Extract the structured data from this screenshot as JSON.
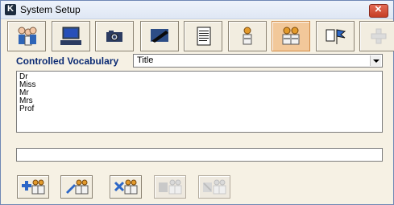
{
  "window": {
    "title": "System Setup",
    "app_icon": "k-app-icon",
    "close_icon": "close-icon"
  },
  "toolbar": {
    "buttons": [
      {
        "icon": "people-icon",
        "active": false
      },
      {
        "icon": "computer-icon",
        "active": false
      },
      {
        "icon": "camera-icon",
        "active": false
      },
      {
        "icon": "pen-icon",
        "active": false
      },
      {
        "icon": "document-icon",
        "active": false
      },
      {
        "icon": "person-icon",
        "active": false
      },
      {
        "icon": "two-people-icon",
        "active": true
      },
      {
        "icon": "flag-icon",
        "active": false
      },
      {
        "icon": "plus-disabled-icon",
        "active": false
      }
    ]
  },
  "controlled_vocabulary": {
    "label": "Controlled Vocabulary",
    "selected": "Title",
    "items": [
      "Dr",
      "Miss",
      "Mr",
      "Mrs",
      "Prof"
    ],
    "entry_value": ""
  },
  "actions": {
    "buttons": [
      {
        "icon": "add-entry-icon",
        "enabled": true
      },
      {
        "icon": "edit-entry-icon",
        "enabled": true
      },
      {
        "icon": "delete-entry-icon",
        "enabled": true
      },
      {
        "icon": "move-entry-disabled-icon",
        "enabled": false
      },
      {
        "icon": "merge-entry-disabled-icon",
        "enabled": false
      }
    ]
  },
  "colors": {
    "label_blue": "#0b2a73",
    "toolbar_active": "#f2c89a",
    "panel_bg": "#f6f1e4"
  }
}
